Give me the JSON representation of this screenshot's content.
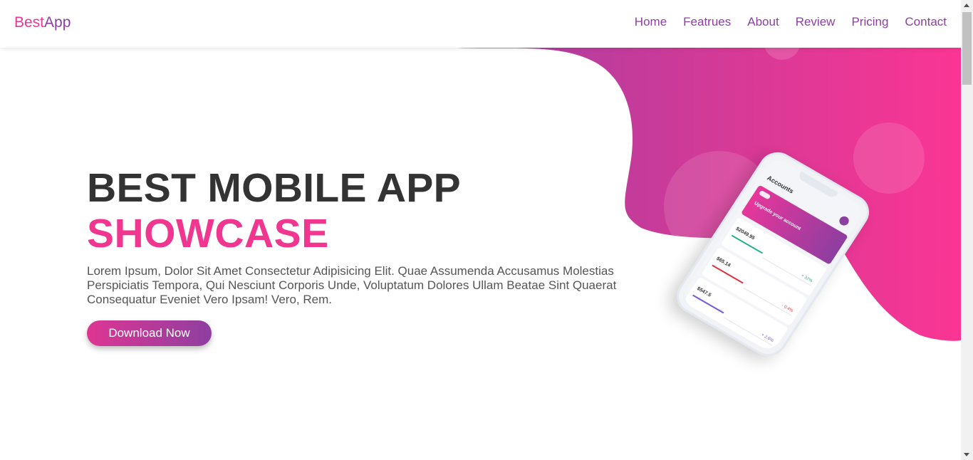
{
  "header": {
    "logo_part1": "Best",
    "logo_part2": "App",
    "nav": [
      "Home",
      "Featrues",
      "About",
      "Review",
      "Pricing",
      "Contact"
    ]
  },
  "hero": {
    "title_line1": "BEST MOBILE APP",
    "title_line2": "SHOWCASE",
    "description": "Lorem Ipsum, Dolor Sit Amet Consectetur Adipisicing Elit. Quae Assumenda Accusamus Molestias Perspiciatis Tempora, Qui Nesciunt Corporis Unde, Voluptatum Dolores Ullam Beatae Sint Quaerat Consequatur Eveniet Vero Ipsam! Vero, Rem.",
    "button_label": "Download Now"
  },
  "phone_screen": {
    "title": "Accounts",
    "banner_text": "Upgrade your account",
    "cards": [
      {
        "value": "$2049.95",
        "percent": "+ 32%",
        "color": "#1fb08a"
      },
      {
        "value": "$65.14",
        "percent": "- 0.4%",
        "color": "#e0303e"
      },
      {
        "value": "$547.5",
        "percent": "+ 2.6%",
        "color": "#7a5bd6"
      }
    ]
  },
  "colors": {
    "pink": "#f0368f",
    "purple": "#8d3ea1",
    "dark_text": "#333333"
  }
}
